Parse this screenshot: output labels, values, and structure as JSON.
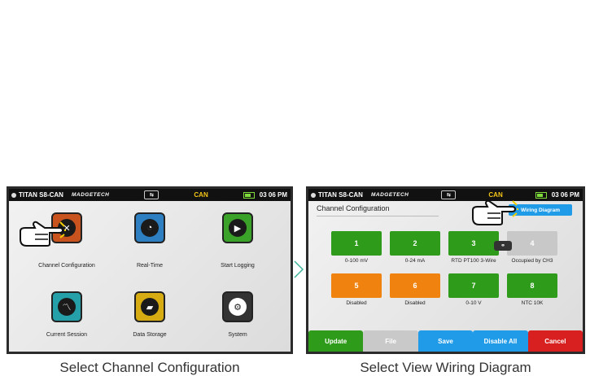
{
  "status_bar": {
    "device_name": "TITAN S8-CAN",
    "brand": "MADGETECH",
    "usb_icon": "usb-icon",
    "mode": "CAN",
    "time": "03 06 PM"
  },
  "home_screen": {
    "apps": [
      {
        "label": "Channel Configuration",
        "icon": "channel-config-icon",
        "color": "#c8531e"
      },
      {
        "label": "Real-Time",
        "icon": "gauge-icon",
        "color": "#2d7fc1"
      },
      {
        "label": "Start Logging",
        "icon": "play-icon",
        "color": "#3aa228"
      },
      {
        "label": "Current Session",
        "icon": "graph-icon",
        "color": "#25a0a8"
      },
      {
        "label": "Data Storage",
        "icon": "folder-icon",
        "color": "#d6ac12"
      },
      {
        "label": "System",
        "icon": "gear-icon",
        "color": "#333333"
      }
    ]
  },
  "config_screen": {
    "title": "Channel Configuration",
    "wiring_button": "Wiring Diagram",
    "channels": [
      {
        "number": "1",
        "label": "0-100 mV",
        "color": "green"
      },
      {
        "number": "2",
        "label": "0-24 mA",
        "color": "green"
      },
      {
        "number": "3",
        "label": "RTD PT100 3-Wire",
        "color": "green"
      },
      {
        "number": "4",
        "label": "Occupied by CH3",
        "color": "gray"
      },
      {
        "number": "5",
        "label": "Disabled",
        "color": "orange"
      },
      {
        "number": "6",
        "label": "Disabled",
        "color": "orange"
      },
      {
        "number": "7",
        "label": "0-10 V",
        "color": "green"
      },
      {
        "number": "8",
        "label": "NTC 10K",
        "color": "green"
      }
    ],
    "buttons": {
      "update": "Update",
      "file": "File",
      "save": "Save",
      "disable_all": "Disable All",
      "cancel": "Cancel"
    }
  },
  "captions": {
    "left": "Select Channel Configuration",
    "right": "Select View Wiring Diagram"
  }
}
